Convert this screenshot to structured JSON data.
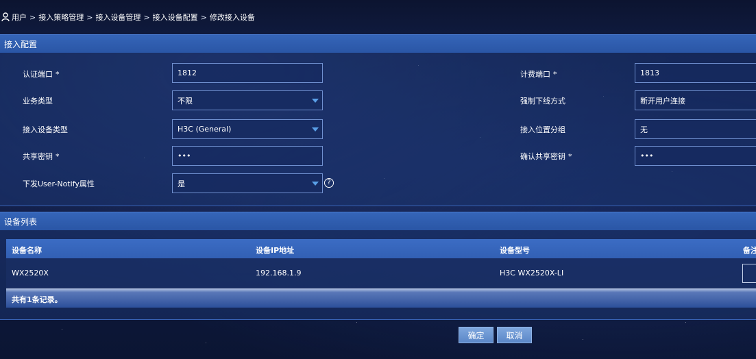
{
  "breadcrumb": {
    "items": [
      "用户",
      "接入策略管理",
      "接入设备管理",
      "接入设备配置",
      "修改接入设备"
    ],
    "separator": ">"
  },
  "access_config": {
    "title": "接入配置",
    "required_mark": "*",
    "auth_port": {
      "label": "认证端口",
      "value": "1812"
    },
    "acct_port": {
      "label": "计费端口",
      "value": "1813"
    },
    "service_type": {
      "label": "业务类型",
      "value": "不限"
    },
    "force_offline": {
      "label": "强制下线方式",
      "value": "断开用户连接"
    },
    "device_type": {
      "label": "接入设备类型",
      "value": "H3C (General)"
    },
    "location_group": {
      "label": "接入位置分组",
      "value": "无"
    },
    "shared_key": {
      "label": "共享密钥",
      "value": "•••"
    },
    "confirm_key": {
      "label": "确认共享密钥",
      "value": "•••"
    },
    "user_notify": {
      "label": "下发User-Notify属性",
      "value": "是",
      "help": "?"
    }
  },
  "device_list": {
    "title": "设备列表",
    "columns": [
      "设备名称",
      "设备IP地址",
      "设备型号",
      "备注"
    ],
    "rows": [
      {
        "name": "WX2520X",
        "ip": "192.168.1.9",
        "model": "H3C WX2520X-LI"
      }
    ],
    "footer": "共有1条记录。"
  },
  "actions": {
    "confirm": "确定",
    "cancel": "取消"
  },
  "colors": {
    "panel_header": "#2f5fb0",
    "button": "#6a94d2",
    "background": "#0f1a3d"
  }
}
